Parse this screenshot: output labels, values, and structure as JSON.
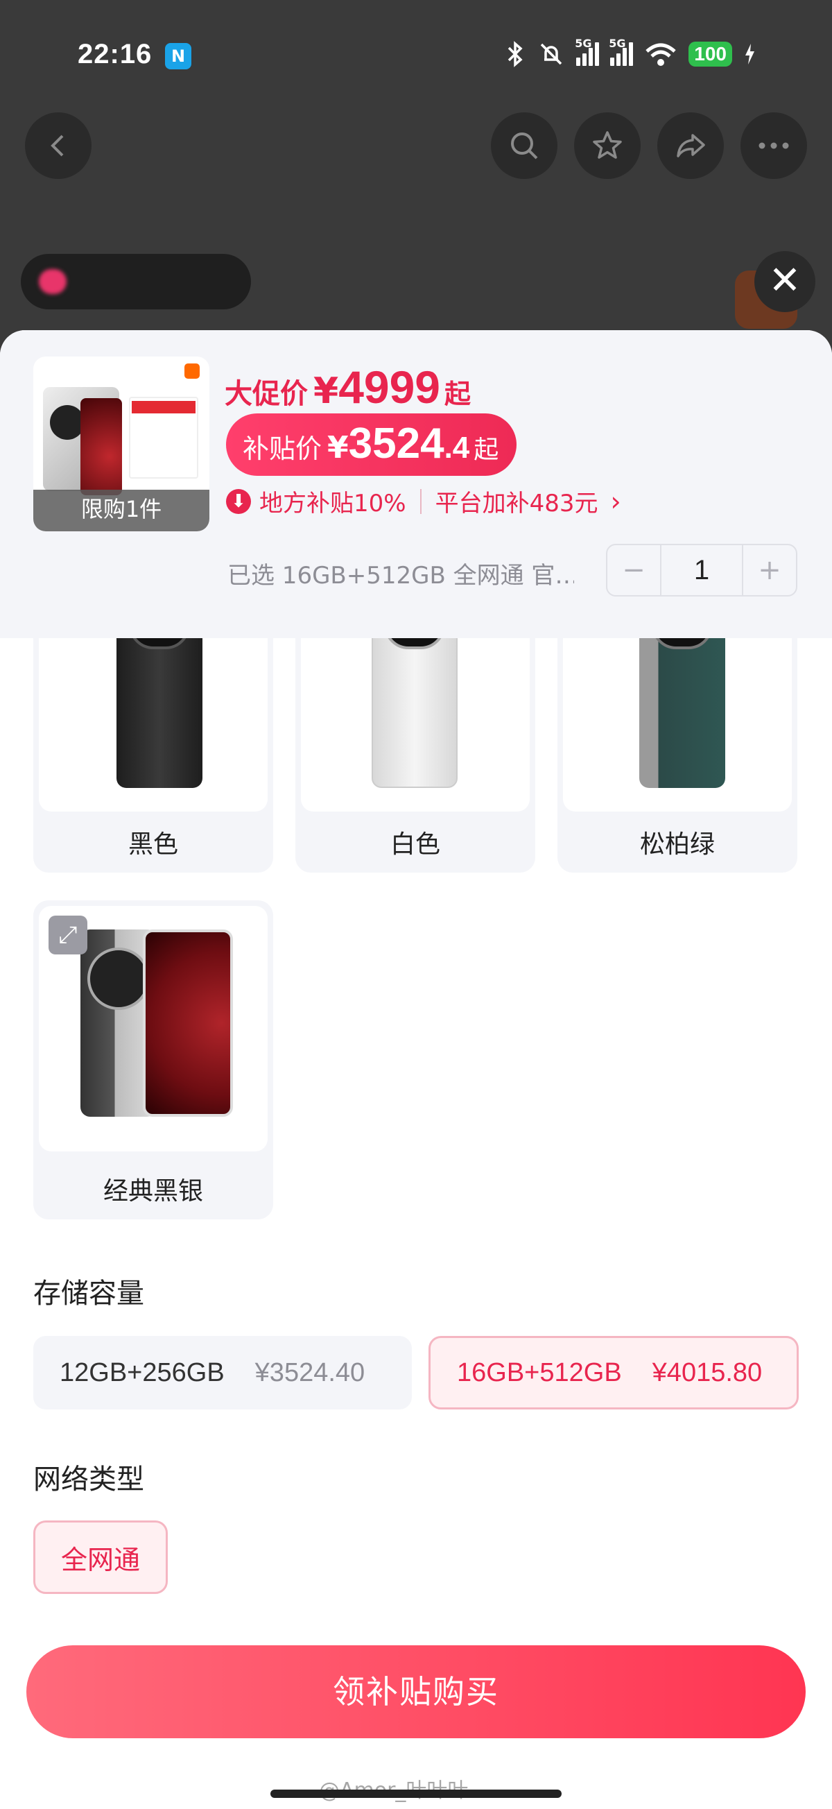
{
  "status_bar": {
    "time": "22:16",
    "nfc": "N",
    "net1": "5G",
    "net2": "5G",
    "battery": "100"
  },
  "sheet": {
    "thumb_badge": "限购1件",
    "promo": {
      "label": "大促价",
      "currency": "¥",
      "value": "4999",
      "suffix": "起"
    },
    "subsidy": {
      "label": "补贴价",
      "currency": "¥",
      "value_int": "3524",
      "value_dec": ".4",
      "suffix": "起"
    },
    "local_subsidy": "地方补贴10%",
    "platform_subsidy": "平台加补483元",
    "selected": "已选 16GB+512GB 全网通 官…",
    "quantity": "1",
    "minus": "−",
    "plus": "+"
  },
  "colors": [
    {
      "name": "黑色"
    },
    {
      "name": "白色"
    },
    {
      "name": "松柏绿"
    },
    {
      "name": "经典黑银"
    }
  ],
  "storage": {
    "title": "存储容量",
    "options": [
      {
        "spec": "12GB+256GB",
        "price": "¥3524.40"
      },
      {
        "spec": "16GB+512GB",
        "price": "¥4015.80"
      }
    ]
  },
  "network": {
    "title": "网络类型",
    "options": [
      {
        "label": "全网通"
      }
    ]
  },
  "buy_button": "领补贴购买",
  "watermark": "@Amor_叶叶叶"
}
